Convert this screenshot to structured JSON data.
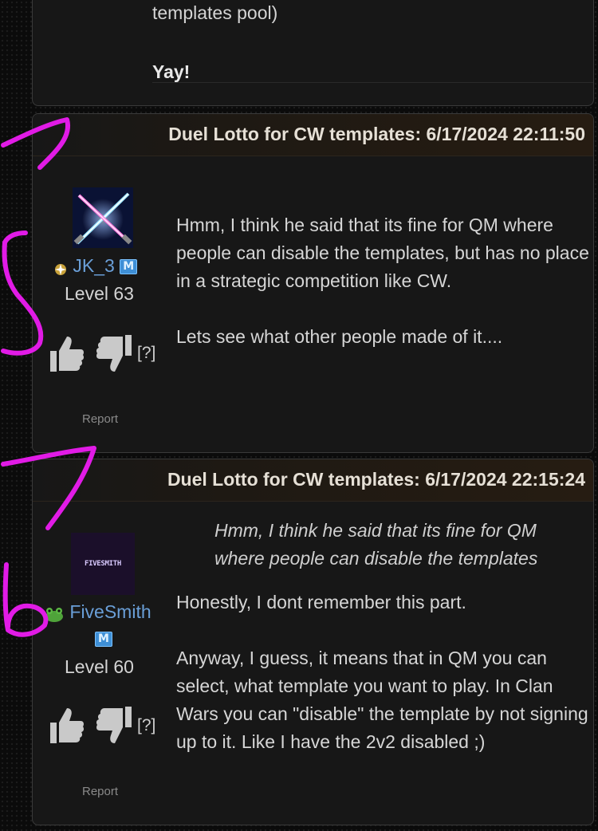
{
  "previous_post": {
    "text_line": "templates pool)",
    "closing": "Yay!"
  },
  "posts": [
    {
      "title": "Duel Lotto for CW templates: 6/17/2024 22:11:50",
      "username": "JK_3",
      "member_badge": "M",
      "level": "Level 63",
      "vote_help": "[?]",
      "report": "Report",
      "avatar_icon": "crossed-lightsabers-avatar",
      "body": [
        "Hmm, I think he said that its fine for QM where people can disable the templates, but has no place in a strategic competition like CW.",
        "Lets see what other people made of it...."
      ]
    },
    {
      "title": "Duel Lotto for CW templates: 6/17/2024 22:15:24",
      "username": "FiveSmith",
      "member_badge": "M",
      "level": "Level 60",
      "vote_help": "[?]",
      "report": "Report",
      "avatar_text": "FIVESMITH",
      "quote": "Hmm, I think he said that its fine for QM where people can disable the templates",
      "body": [
        "Honestly, I dont remember this part.",
        "Anyway, I guess, it means that in QM you can select, what template you want to play. In Clan Wars you can \"disable\" the template by not signing up to it. Like I have the 2v2 disabled ;)"
      ]
    }
  ],
  "colors": {
    "accent_username": "#6a9fd8",
    "annotation_pen": "#e11be6",
    "header_tint": "#261c12"
  }
}
